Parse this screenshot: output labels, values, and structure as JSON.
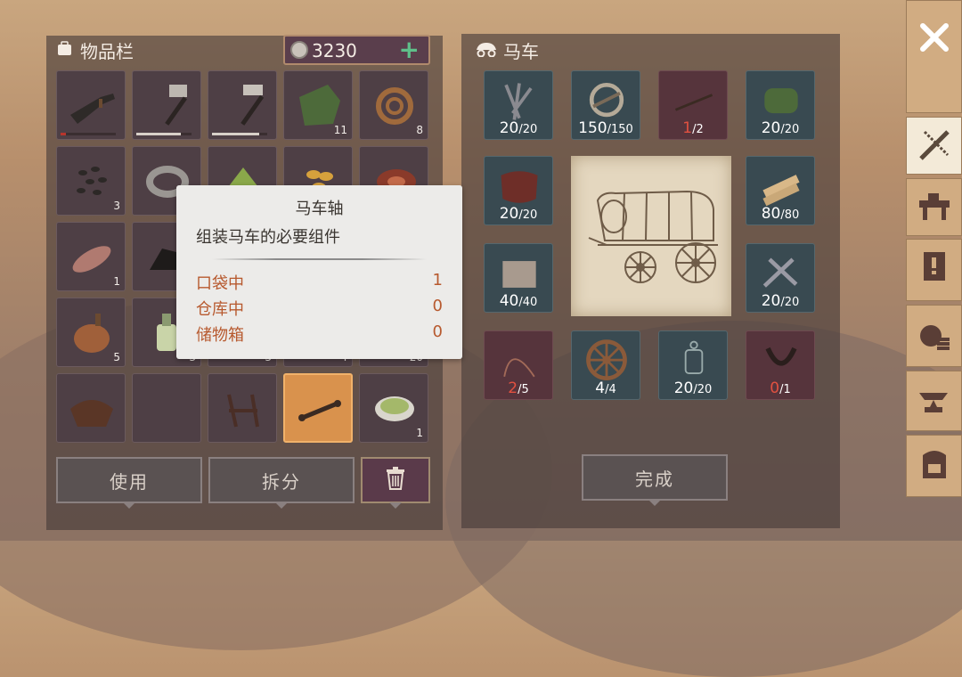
{
  "inventory": {
    "title": "物品栏",
    "currency": "3230",
    "slots": [
      {
        "name": "flintlock-pistol",
        "count": "",
        "bar": 0.1,
        "barRed": true
      },
      {
        "name": "sledgehammer",
        "count": "",
        "bar": 0.8
      },
      {
        "name": "hammer",
        "count": "",
        "bar": 0.85
      },
      {
        "name": "green-cloth",
        "count": "11"
      },
      {
        "name": "rope",
        "count": "8"
      },
      {
        "name": "seeds",
        "count": "3"
      },
      {
        "name": "iron-ring",
        "count": ""
      },
      {
        "name": "herbs",
        "count": ""
      },
      {
        "name": "grain",
        "count": ""
      },
      {
        "name": "meat",
        "count": ""
      },
      {
        "name": "fish",
        "count": "1"
      },
      {
        "name": "coal",
        "count": ""
      },
      {
        "name": "empty",
        "count": ""
      },
      {
        "name": "empty",
        "count": ""
      },
      {
        "name": "empty",
        "count": ""
      },
      {
        "name": "water-flask",
        "count": "5"
      },
      {
        "name": "bottle",
        "count": "3"
      },
      {
        "name": "hidden",
        "count": "3"
      },
      {
        "name": "hidden",
        "count": "4"
      },
      {
        "name": "hidden",
        "count": "20"
      },
      {
        "name": "saddle",
        "count": ""
      },
      {
        "name": "empty",
        "count": ""
      },
      {
        "name": "bridle",
        "count": ""
      },
      {
        "name": "wagon-axle",
        "count": "",
        "selected": true
      },
      {
        "name": "bowl",
        "count": "1"
      }
    ],
    "buttons": {
      "use": "使用",
      "split": "拆分"
    }
  },
  "wagon": {
    "title": "马车",
    "materials": [
      {
        "name": "nails",
        "have": "20",
        "total": "/20"
      },
      {
        "name": "scrap-metal",
        "have": "150",
        "total": "/150"
      },
      {
        "name": "wagon-axle",
        "have": "1",
        "total": "/2",
        "bad": true
      },
      {
        "name": "green-fabric",
        "have": "20",
        "total": "/20"
      },
      {
        "name": "leather",
        "have": "20",
        "total": "/20"
      },
      {
        "name": "planks",
        "have": "80",
        "total": "/80"
      },
      {
        "name": "stone",
        "have": "40",
        "total": "/40"
      },
      {
        "name": "tools",
        "have": "20",
        "total": "/20"
      },
      {
        "name": "wire",
        "have": "2",
        "total": "/5",
        "bad": true
      },
      {
        "name": "wheel",
        "have": "4",
        "total": "/4"
      },
      {
        "name": "lantern",
        "have": "20",
        "total": "/20"
      },
      {
        "name": "harness",
        "have": "0",
        "total": "/1",
        "bad": true
      }
    ],
    "done_label": "完成"
  },
  "tooltip": {
    "title": "马车轴",
    "desc": "组装马车的必要组件",
    "rows": [
      {
        "label": "口袋中",
        "value": "1"
      },
      {
        "label": "仓库中",
        "value": "0"
      },
      {
        "label": "储物箱",
        "value": "0"
      }
    ]
  },
  "colors": {
    "accent": "#d9924d",
    "bad": "#e25140",
    "panel": "#4e3f45"
  }
}
